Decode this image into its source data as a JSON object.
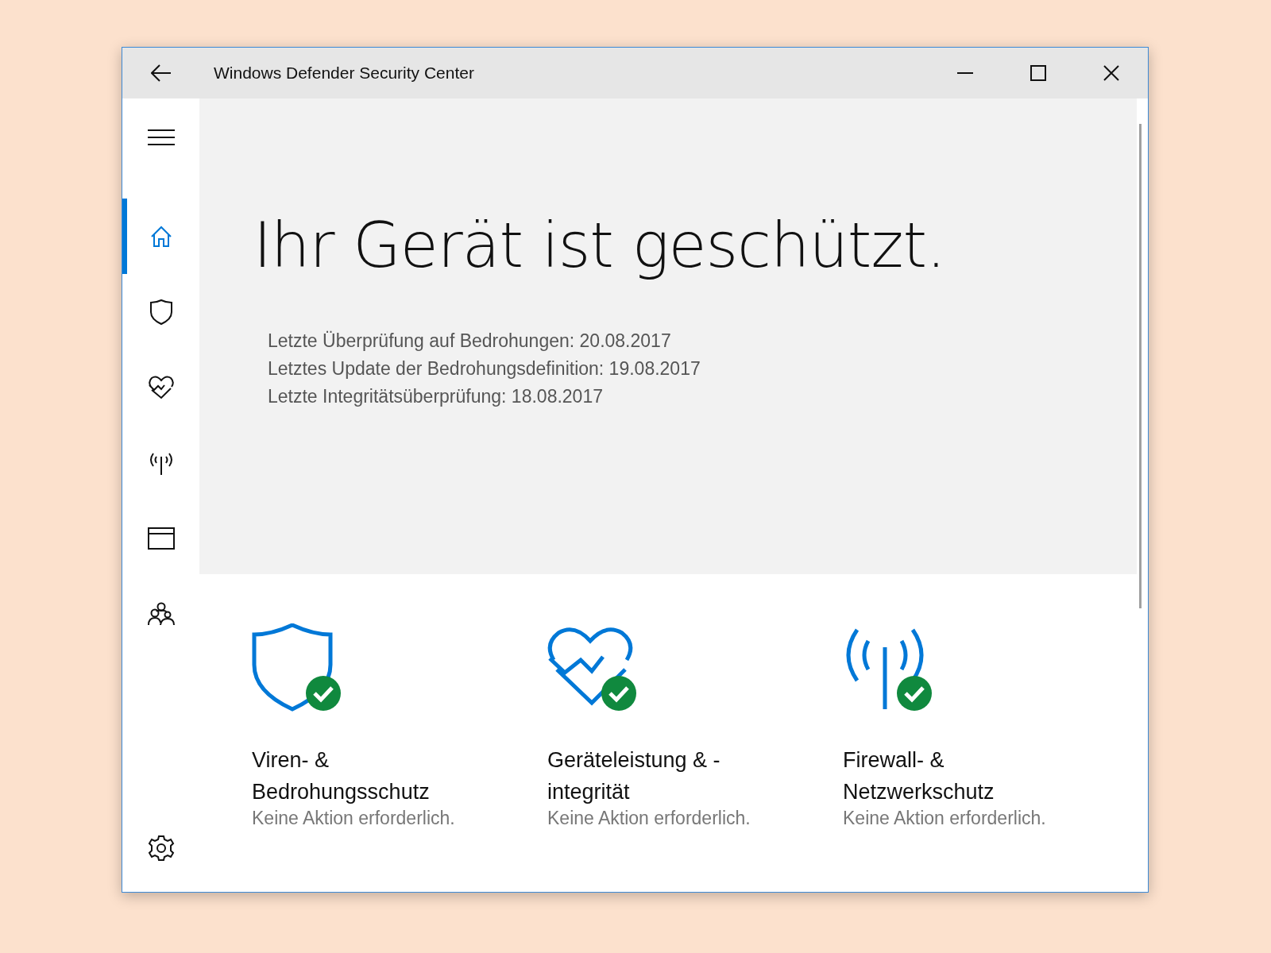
{
  "window": {
    "title": "Windows Defender Security Center"
  },
  "sidebar": {
    "items": [
      {
        "kind": "home",
        "selected": true
      },
      {
        "kind": "shield",
        "selected": false
      },
      {
        "kind": "heart",
        "selected": false
      },
      {
        "kind": "antenna",
        "selected": false
      },
      {
        "kind": "browser",
        "selected": false
      },
      {
        "kind": "family",
        "selected": false
      }
    ]
  },
  "hero": {
    "headline": "Ihr Gerät ist geschützt.",
    "details": [
      "Letzte Überprüfung auf Bedrohungen:  20.08.2017",
      "Letztes Update der Bedrohungsdefinition:  19.08.2017",
      "Letzte Integritätsüberprüfung:  18.08.2017"
    ]
  },
  "cards": [
    {
      "kind": "shield",
      "title_lines": [
        "Viren- &",
        "Bedrohungsschutz"
      ],
      "status": "Keine Aktion erforderlich."
    },
    {
      "kind": "heart",
      "title_lines": [
        "Geräteleistung & -",
        "integrität"
      ],
      "status": "Keine Aktion erforderlich."
    },
    {
      "kind": "antenna",
      "title_lines": [
        "Firewall- &",
        "Netzwerkschutz"
      ],
      "status": "Keine Aktion erforderlich."
    }
  ]
}
